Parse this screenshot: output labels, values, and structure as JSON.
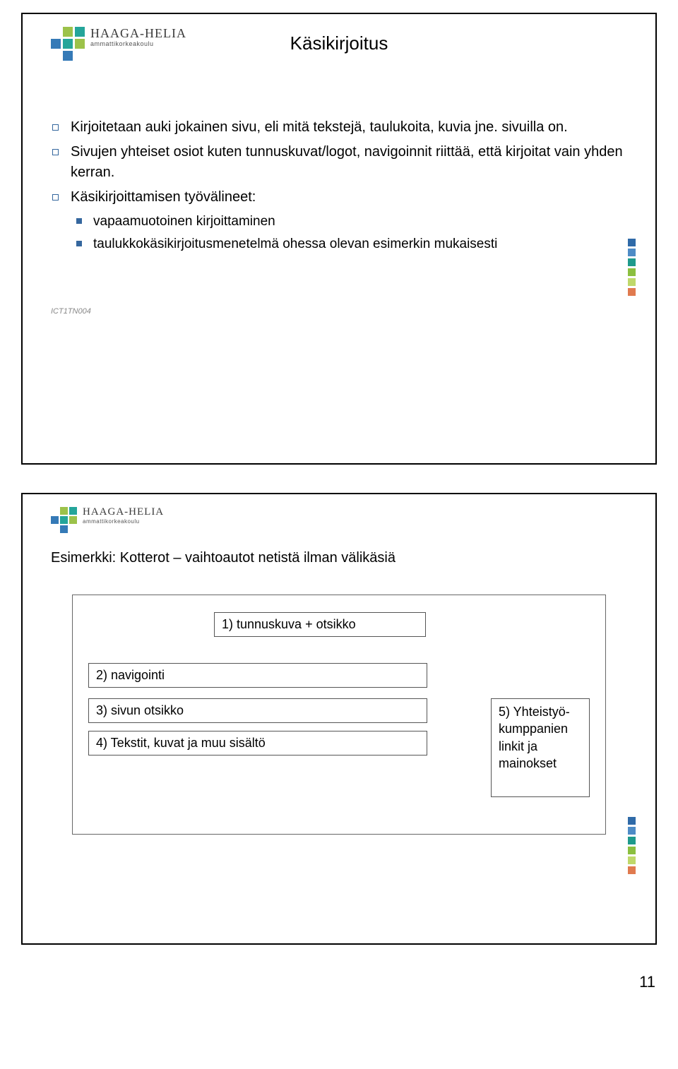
{
  "logo": {
    "name": "HAAGA-HELIA",
    "sub": "ammattikorkeakoulu"
  },
  "slide1": {
    "title": "Käsikirjoitus",
    "bullets": [
      "Kirjoitetaan auki jokainen sivu, eli mitä tekstejä, taulukoita, kuvia jne. sivuilla on.",
      "Sivujen yhteiset osiot kuten tunnuskuvat/logot, navigoinnit riittää, että kirjoitat vain yhden kerran.",
      "Käsikirjoittamisen työvälineet:"
    ],
    "subbullets": [
      "vapaamuotoinen kirjoittaminen",
      "taulukkokäsikirjoitusmenetelmä ohessa olevan esimerkin mukaisesti"
    ],
    "footer": "ICT1TN004"
  },
  "slide2": {
    "example_title": "Esimerkki: Kotterot – vaihtoautot netistä ilman välikäsiä",
    "wireframe": {
      "top": "1) tunnuskuva + otsikko",
      "nav": "2) navigointi",
      "h3": "3) sivun otsikko",
      "body": "4) Tekstit, kuvat ja muu sisältö",
      "side": "5) Yhteistyö­kumppa­nien linkit ja mainokset"
    }
  },
  "page_number": "11"
}
